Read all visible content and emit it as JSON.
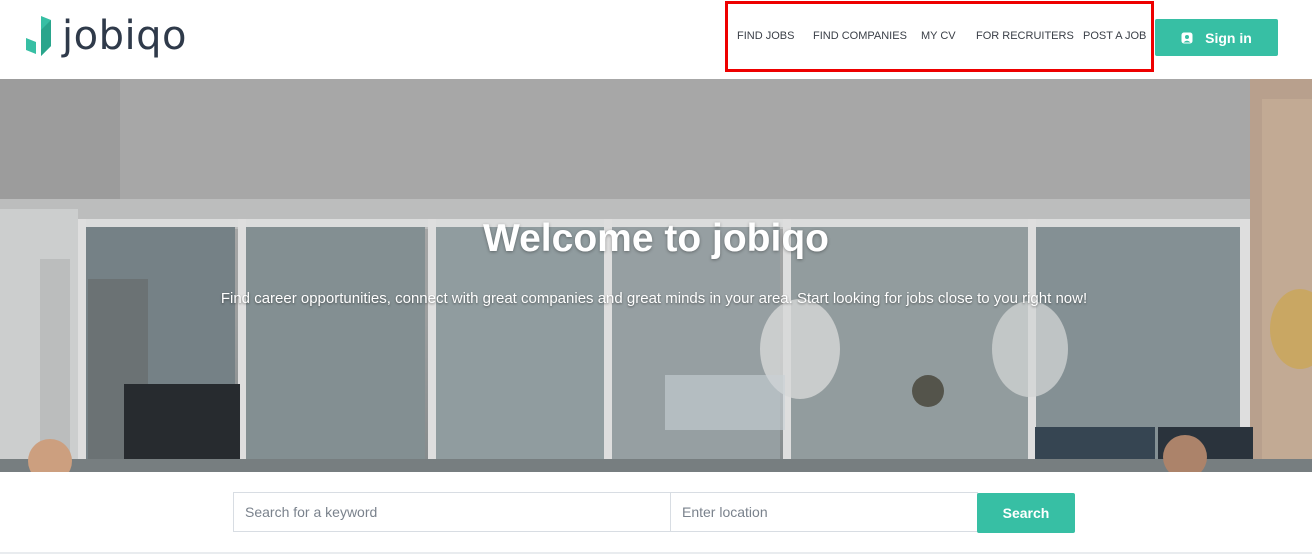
{
  "brand": {
    "name": "jobiqo",
    "accent": "#37bfa4",
    "text_color": "#2f3a4a"
  },
  "nav": {
    "items": [
      {
        "label": "FIND JOBS"
      },
      {
        "label": "FIND COMPANIES"
      },
      {
        "label": "MY CV"
      },
      {
        "label": "FOR RECRUITERS"
      },
      {
        "label": "POST A JOB"
      }
    ],
    "highlight_color": "#ee0000"
  },
  "signin": {
    "label": "Sign in",
    "icon": "user-badge-icon"
  },
  "hero": {
    "title": "Welcome to jobiqo",
    "subtitle": "Find career opportunities, connect with great companies and great minds in your area. Start looking for jobs close to you right now!"
  },
  "search": {
    "keyword_placeholder": "Search for a keyword",
    "location_placeholder": "Enter location",
    "button_label": "Search",
    "icon": "search-button"
  }
}
